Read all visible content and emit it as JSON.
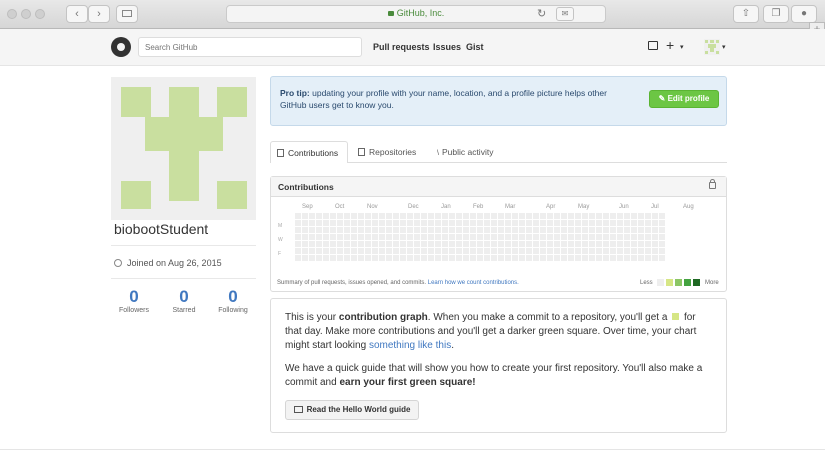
{
  "browser": {
    "url": "GitHub, Inc.",
    "reload_glyph": "↻",
    "back_glyph": "‹",
    "forward_glyph": "›",
    "newtab_glyph": "+"
  },
  "header": {
    "search_placeholder": "Search GitHub",
    "nav": [
      "Pull requests",
      "Issues",
      "Gist"
    ],
    "plus_glyph": "+",
    "caret_glyph": "▾"
  },
  "profile": {
    "username": "biobootStudent",
    "joined": "Joined on Aug 26, 2015",
    "stats": [
      {
        "value": "0",
        "label": "Followers"
      },
      {
        "value": "0",
        "label": "Starred"
      },
      {
        "value": "0",
        "label": "Following"
      }
    ]
  },
  "protip": {
    "lead": "Pro tip:",
    "text": " updating your profile with your name, location, and a profile picture helps other GitHub users get to know you.",
    "button": "✎ Edit profile"
  },
  "tabs": [
    "Contributions",
    "Repositories",
    "Public activity"
  ],
  "contributions": {
    "title": "Contributions",
    "months": [
      "Sep",
      "Oct",
      "Nov",
      "Dec",
      "Jan",
      "Feb",
      "Mar",
      "Apr",
      "May",
      "Jun",
      "Jul",
      "Aug"
    ],
    "days": [
      "M",
      "W",
      "F"
    ],
    "summary": "Summary of pull requests, issues opened, and commits.",
    "summary_link": "Learn how we count contributions.",
    "less": "Less",
    "more": "More",
    "legend_colors": [
      "#eeeeee",
      "#d6e685",
      "#8cc665",
      "#44a340",
      "#1e6823"
    ]
  },
  "info": {
    "p1_a": "This is your ",
    "p1_b": "contribution graph",
    "p1_c": ". When you make a commit to a repository, you'll get a ",
    "p1_d": " for that day. Make more contributions and you'll get a darker green square. Over time, your chart might start looking ",
    "p1_link": "something like this",
    "p1_e": ".",
    "p2_a": "We have a quick guide that will show you how to create your first repository. You'll also make a commit and ",
    "p2_b": "earn your first green square!",
    "button": "Read the Hello World guide"
  },
  "colors": {
    "accent_green": "#6cc644",
    "link_blue": "#4078c0",
    "identicon": "#c9df9f"
  }
}
